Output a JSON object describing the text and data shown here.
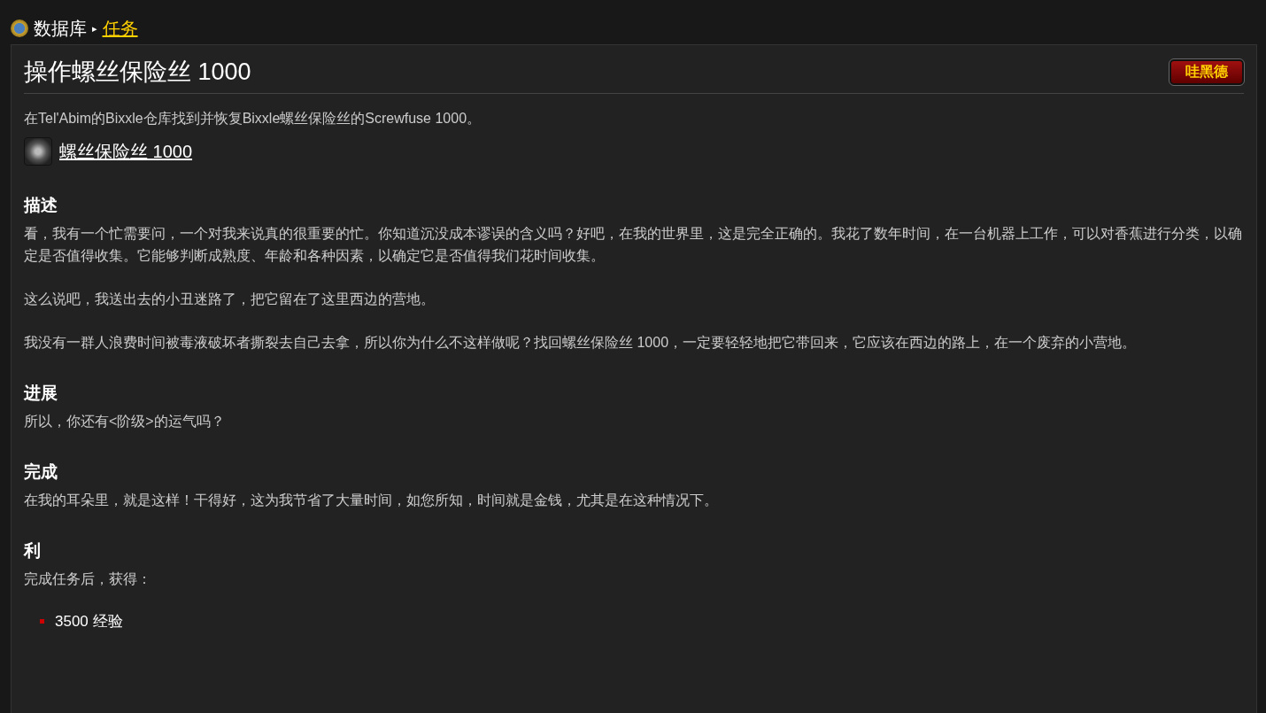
{
  "breadcrumb": {
    "root": "数据库",
    "separator": "▸",
    "current": "任务"
  },
  "quest": {
    "title": "操作螺丝保险丝 1000",
    "faction_badge": "哇黑德",
    "objective": "在Tel'Abim的Bixxle仓库找到并恢复Bixxle螺丝保险丝的Screwfuse 1000。",
    "item_link": "螺丝保险丝 1000"
  },
  "sections": [
    {
      "heading": "描述",
      "paragraphs": [
        "看，我有一个忙需要问，一个对我来说真的很重要的忙。你知道沉没成本谬误的含义吗？好吧，在我的世界里，这是完全正确的。我花了数年时间，在一台机器上工作，可以对香蕉进行分类，以确定是否值得收集。它能够判断成熟度、年龄和各种因素，以确定它是否值得我们花时间收集。",
        "这么说吧，我送出去的小丑迷路了，把它留在了这里西边的营地。",
        "我没有一群人浪费时间被毒液破坏者撕裂去自己去拿，所以你为什么不这样做呢？找回螺丝保险丝 1000，一定要轻轻地把它带回来，它应该在西边的路上，在一个废弃的小营地。"
      ]
    },
    {
      "heading": "进展",
      "paragraphs": [
        "所以，你还有<阶级>的运气吗？"
      ]
    },
    {
      "heading": "完成",
      "paragraphs": [
        "在我的耳朵里，就是这样！干得好，这为我节省了大量时间，如您所知，时间就是金钱，尤其是在这种情况下。"
      ]
    },
    {
      "heading": "利",
      "paragraphs": [
        "完成任务后，获得："
      ],
      "bullets": [
        "3500 经验"
      ]
    }
  ]
}
